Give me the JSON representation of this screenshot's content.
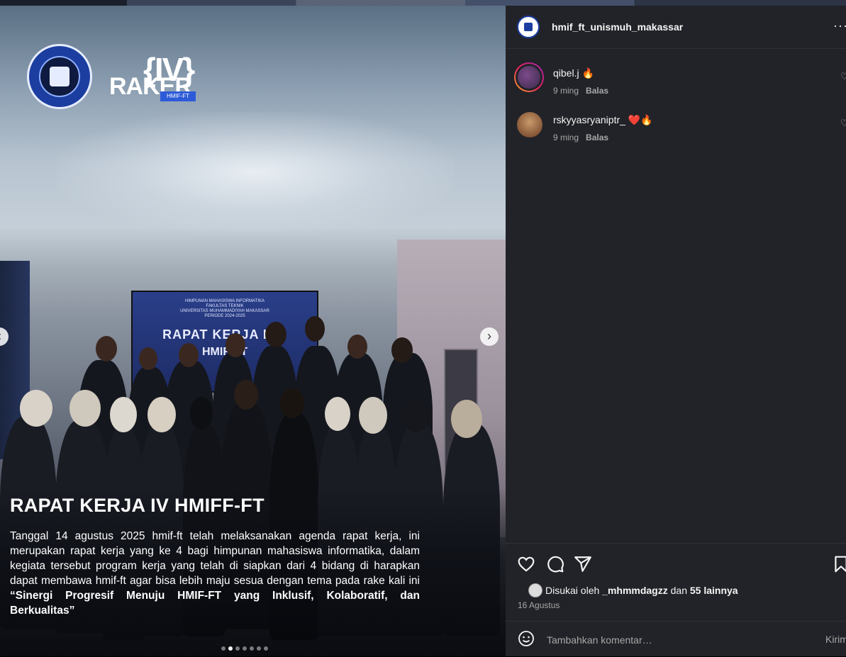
{
  "post_image": {
    "banner_line1": "HIMPUNAN MAHASISWA INFORMATIKA",
    "banner_line2": "FAKULTAS TEKNIK",
    "banner_line3": "UNIVERSITAS MUHAMMADIYAH MAKASSAR",
    "banner_line4": "PERIODE 2024-2025",
    "banner_title": "RAPAT KERJA KE-",
    "banner_sub": "HMIF-FT",
    "logo_raker": "RAKER",
    "logo_roman": "{IV}",
    "logo_tag": "HMIF-FT",
    "caption_title": "RAPAT KERJA IV HMIFF-FT",
    "caption_body": "Tanggal 14 agustus 2025 hmif-ft telah melaksanakan agenda rapat kerja, ini merupakan rapat kerja yang ke 4 bagi himpunan mahasiswa informatika, dalam kegiata tersebut program kerja yang telah di siapkan dari 4 bidang di harapkan dapat membawa hmif-ft agar bisa lebih maju sesua dengan tema pada rake kali ini ",
    "caption_quote": "“Sinergi Progresif Menuju HMIF-FT yang Inklusif, Kolaboratif, dan Berkualitas”",
    "carousel_count": 7,
    "carousel_active_index": 1
  },
  "header": {
    "account_name": "hmif_ft_unismuh_makassar",
    "more_glyph": "···"
  },
  "comments": [
    {
      "user": "qibel.j",
      "text": " 🔥",
      "time": "9 ming",
      "reply": "Balas"
    },
    {
      "user": "rskyyasryaniptr_",
      "text": " ❤️🔥",
      "time": "9 ming",
      "reply": "Balas"
    }
  ],
  "likes": {
    "prefix": "Disukai oleh ",
    "liker": "_mhmmdagzz",
    "middle": " dan ",
    "others": "55 lainnya"
  },
  "post_date": "16 Agustus",
  "add_comment": {
    "placeholder": "Tambahkan komentar…",
    "send": "Kirim"
  },
  "nav": {
    "next": "›",
    "prev": "‹"
  }
}
